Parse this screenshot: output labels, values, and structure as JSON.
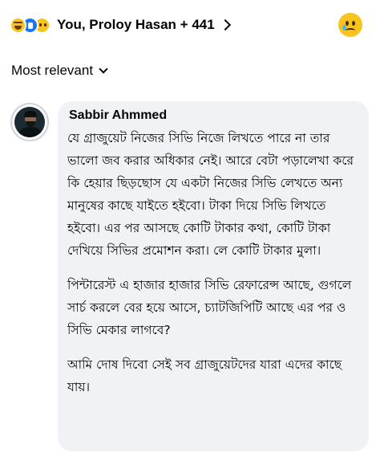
{
  "reactions": {
    "icons": [
      "haha-reaction-icon",
      "like-reaction-icon",
      "sad-reaction-icon"
    ],
    "summary": "You, Proloy Hasan + 441",
    "my_reaction_icon": "sad-face-icon"
  },
  "sort": {
    "label": "Most relevant"
  },
  "comment": {
    "author": "Sabbir Ahmmed",
    "paragraphs": [
      "যে গ্রাজুয়েট নিজের সিভি নিজে লিখতে পারে না তার ভালো জব করার অধিকার নেই। আরে বেটা পড়ালেখা করে কি হেয়ার ছিড়ছোস যে একটা নিজের সিভি লেখতে অন্য মানুষের কাছে যাইতে হইবো। টাকা দিয়ে সিভি লিখতে হইবো। এর পর আসছে কোটি টাকার কথা, কোটি টাকা দেখিয়ে সিভির প্রমোশন করা। লে কোটি টাকার মুলা।",
      "পিন্টারেস্ট এ হাজার হাজার সিভি রেফারেন্স আছে, গুগলে সার্চ করলে বের হয়ে আসে, চ্যাটজিপিটি আছে এর পর ও সিভি মেকার লাগবে?",
      "আমি দোষ দিবো সেই সব গ্রাজুয়েটদের যারা এদের কাছে যায়।"
    ]
  },
  "colors": {
    "bubble_background": "#f0f2f5",
    "text": "#050505",
    "like_blue": "#1877f2",
    "emoji_yellow": "#f7c31e"
  }
}
